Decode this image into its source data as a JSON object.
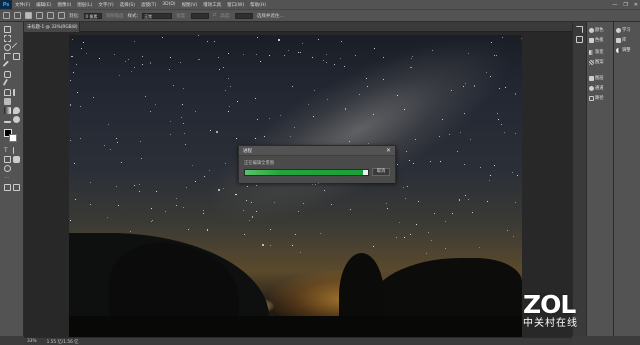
{
  "app": {
    "logo": "Ps"
  },
  "menu": [
    "文件(F)",
    "编辑(E)",
    "图像(I)",
    "图层(L)",
    "文字(Y)",
    "选择(S)",
    "滤镜(T)",
    "3D(D)",
    "视图(V)",
    "增效工具",
    "窗口(W)",
    "帮助(H)"
  ],
  "window_controls": {
    "minimize": "—",
    "maximize": "❐",
    "close": "✕"
  },
  "options": {
    "feather_label": "羽化:",
    "feather_value": "0 像素",
    "antialias_label": "消除锯齿",
    "style_label": "样式:",
    "style_value": "正常",
    "width_label": "宽度:",
    "height_label": "高度:",
    "refine_label": "选择并遮住..."
  },
  "tabs": [
    {
      "label": "未标题-1 @ 33%(RGB/8) *"
    }
  ],
  "dialog": {
    "title": "进程",
    "message": "正在编辑全景图",
    "progress": 0.96,
    "cancel_label": "取消",
    "close": "✕"
  },
  "panels": {
    "col1": [
      {
        "label": "颜色",
        "icon": "color-wheel-icon"
      },
      {
        "label": "色板",
        "icon": "swatches-icon"
      },
      {
        "label": "渐变",
        "icon": "gradient-icon"
      },
      {
        "label": "图案",
        "icon": "pattern-icon"
      },
      {
        "label": "图层",
        "icon": "layers-icon"
      },
      {
        "label": "通道",
        "icon": "channels-icon"
      },
      {
        "label": "路径",
        "icon": "paths-icon"
      }
    ],
    "col2": [
      {
        "label": "学习",
        "icon": "learn-icon"
      },
      {
        "label": "库",
        "icon": "library-icon"
      },
      {
        "label": "调整",
        "icon": "adjustments-icon"
      }
    ]
  },
  "status": {
    "zoom": "33%",
    "doc_info": "1.55 亿/1.56 亿"
  },
  "watermark": {
    "logo": "ZOL",
    "subtitle": "中关村在线"
  }
}
